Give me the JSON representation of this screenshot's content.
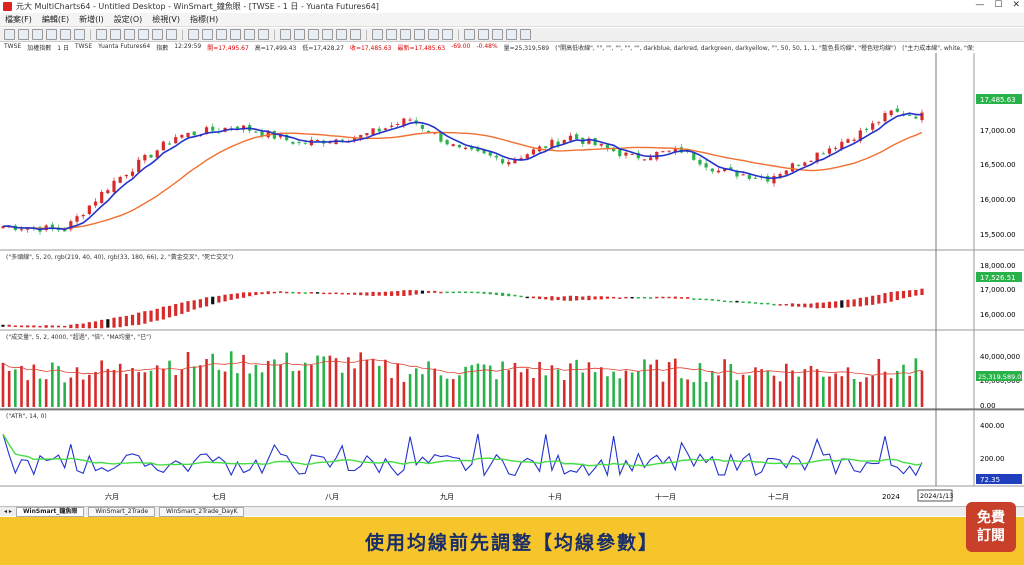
{
  "window": {
    "title": "元大 MultiCharts64 - Untitled Desktop - WinSmart_鐘魚眼 - [TWSE - 1 日 - Yuanta Futures64]",
    "min": "—",
    "max": "☐",
    "close": "✕"
  },
  "menu": [
    "檔案(F)",
    "編輯(E)",
    "新增(I)",
    "設定(O)",
    "檢視(V)",
    "指標(H)"
  ],
  "infobar": {
    "symbol": "TWSE",
    "name": "加權指數",
    "resolution": "1 日",
    "exchange": "TWSE",
    "source": "Yuanta Futures64",
    "kind": "指數",
    "time": "12:29:59",
    "open": "開=17,495.67",
    "high": "高=17,499.43",
    "low": "低=17,428.27",
    "close": "收=17,485.63",
    "last": "最新=17,485.63",
    "change": "-69.00",
    "pct": "-0.48%",
    "volume": "量=25,319,589",
    "study": "(\"開高低收線\", \"\", \"\", \"\", \"\", \"\", darkblue, darkred, darkgreen, darkyellow, \"\", 50, 50, 1, 1, \"藍色長均線\", \"橙色短均線\")",
    "study2": "(\"主力成本線\", white, \"保全\""
  },
  "panes": {
    "price": {
      "labels": [
        "17,000.00",
        "16,500.00",
        "16,000.00",
        "15,500.00"
      ],
      "last": "17,485.63"
    },
    "macd": {
      "title": "(\"多頭線\", 5, 20, rgb(219, 40, 40), rgb(33, 180, 66), 2, \"黃金交叉\", \"死亡交叉\")",
      "labels": [
        "18,000.00",
        "17,000.00",
        "16,000.00"
      ],
      "last": "17,526.51"
    },
    "volume": {
      "title": "(\"成交量\", 5, 2, 4000, \"超過\", \"倍\", \"MA均量\", \"已\")",
      "labels": [
        "40,000,000",
        "20,000,000",
        "0.00"
      ],
      "last": "25,319,589.0"
    },
    "atr": {
      "title": "(\"ATR\", 14, 0)",
      "labels": [
        "400.00",
        "200.00"
      ],
      "last": "72.35"
    }
  },
  "xaxis": {
    "ticks": [
      "六月",
      "七月",
      "八月",
      "九月",
      "十月",
      "十一月",
      "十二月",
      "2024"
    ],
    "cursor": "2024/1/13"
  },
  "tabs": [
    "WinSmart_鐘魚眼",
    "WinSmart_2Trade",
    "WinSmart_2Trade_DayK"
  ],
  "banner": {
    "caption": "使用均線前先調整【均線參數】"
  },
  "badge": {
    "line1": "免費",
    "line2": "訂閱"
  },
  "colors": {
    "up": "#d62b2b",
    "down": "#2ab24a",
    "short_ma": "#2233cc",
    "long_ma": "#f07030",
    "banner": "#f5c52b"
  }
}
